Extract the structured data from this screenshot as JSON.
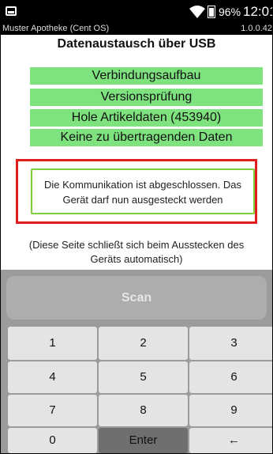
{
  "status_bar": {
    "left_icon": "screen-icon",
    "wifi_icon": "wifi-icon",
    "battery_percent": "96%",
    "time": "12:01"
  },
  "app_bar": {
    "name": "Muster Apotheke (Cent OS)",
    "version": "1.0.0.42"
  },
  "title": "Datenaustausch über USB",
  "steps": [
    "Verbindungsaufbau",
    "Versionsprüfung",
    "Hole Artikeldaten (453940)",
    "Keine zu übertragenden Daten"
  ],
  "message": {
    "line1": "Die Kommunikation ist abgeschlossen. Das",
    "line2": "Gerät darf nun ausgesteckt werden"
  },
  "hint": {
    "line1": "(Diese Seite schließt sich beim Ausstecken des",
    "line2": "Geräts automatisch)"
  },
  "keypad": {
    "scan_label": "Scan",
    "keys": [
      "1",
      "2",
      "3",
      "4",
      "5",
      "6",
      "7",
      "8",
      "9",
      "0",
      "Enter",
      "←"
    ]
  }
}
